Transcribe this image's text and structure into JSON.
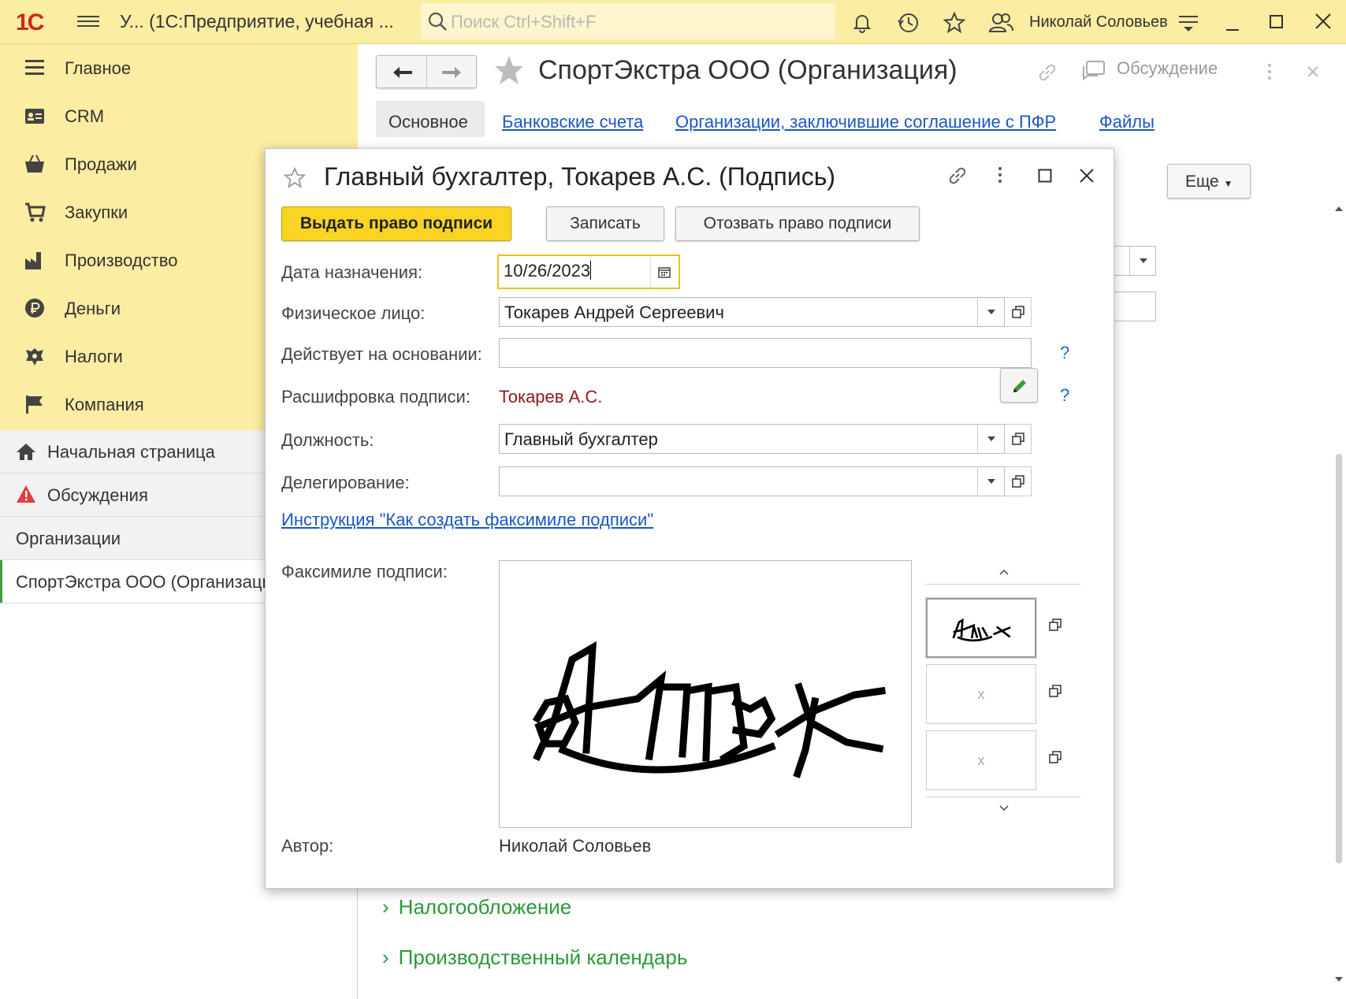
{
  "topbar": {
    "logo": "1С",
    "app_title": "У... (1С:Предприятие, учебная ...",
    "search_placeholder": "Поиск Ctrl+Shift+F",
    "user_name": "Николай Соловьев"
  },
  "sections": [
    {
      "label": "Главное",
      "icon": "menu-icon"
    },
    {
      "label": "CRM",
      "icon": "crm-icon"
    },
    {
      "label": "Продажи",
      "icon": "basket-icon"
    },
    {
      "label": "Закупки",
      "icon": "cart-icon"
    },
    {
      "label": "Производство",
      "icon": "factory-icon"
    },
    {
      "label": "Деньги",
      "icon": "ruble-icon"
    },
    {
      "label": "Налоги",
      "icon": "emblem-icon"
    },
    {
      "label": "Компания",
      "icon": "flag-icon"
    }
  ],
  "nav": {
    "home": "Начальная страница",
    "discussions": "Обсуждения",
    "organizations": "Организации",
    "current": "СпортЭкстра ООО (Организация)"
  },
  "main": {
    "title": "СпортЭкстра ООО (Организация)",
    "discussion": "Обсуждение",
    "tabs": [
      "Основное",
      "Банковские счета",
      "Организации, заключившие соглашение с ПФР",
      "Файлы"
    ],
    "more": "Еще",
    "groups": [
      "Налогообложение",
      "Производственный календарь"
    ]
  },
  "dialog": {
    "title": "Главный бухгалтер, Токарев А.С. (Подпись)",
    "buttons": {
      "grant": "Выдать право подписи",
      "save": "Записать",
      "revoke": "Отозвать право подписи"
    },
    "fields": {
      "date_label": "Дата назначения:",
      "date_value": "10/26/2023",
      "person_label": "Физическое лицо:",
      "person_value": "Токарев Андрей Сергеевич",
      "basis_label": "Действует на основании:",
      "basis_value": "",
      "decode_label": "Расшифровка подписи:",
      "decode_value": "Токарев А.С.",
      "position_label": "Должность:",
      "position_value": "Главный бухгалтер",
      "delegation_label": "Делегирование:",
      "delegation_value": ""
    },
    "instruction_link": "Инструкция \"Как создать факсимиле подписи\"",
    "facsimile_label": "Факсимиле подписи:",
    "empty_thumb": "х",
    "author_label": "Автор:",
    "author_value": "Николай Соловьев",
    "question": "?"
  },
  "colors": {
    "topbar": "#fbeda2",
    "primary_button": "#f9d423",
    "link": "#1a56c4",
    "group": "#2a9a3a",
    "decode": "#8b1a1a"
  }
}
